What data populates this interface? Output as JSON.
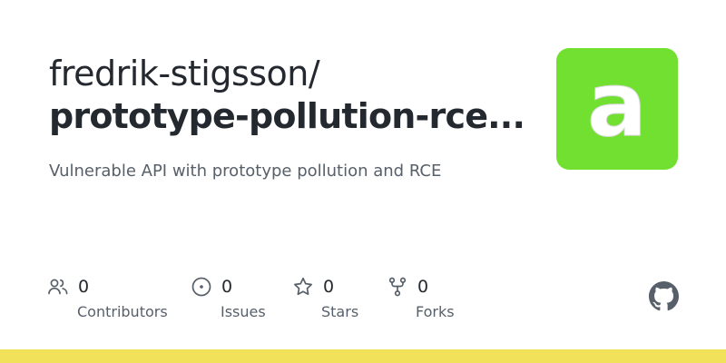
{
  "card": {
    "owner": "fredrik-stigsson/",
    "repo": "prototype-pollution-rce...",
    "description": "Vulnerable API with prototype pollution and RCE",
    "avatar": {
      "letter": "a",
      "color": "#71e030",
      "icon": "repo-avatar"
    },
    "stats": [
      {
        "key": "contributors",
        "icon": "people-icon",
        "count": "0",
        "label": "Contributors"
      },
      {
        "key": "issues",
        "icon": "issue-opened-icon",
        "count": "0",
        "label": "Issues"
      },
      {
        "key": "stars",
        "icon": "star-icon",
        "count": "0",
        "label": "Stars"
      },
      {
        "key": "forks",
        "icon": "repo-forked-icon",
        "count": "0",
        "label": "Forks"
      }
    ],
    "logo_icon": "github-mark-icon",
    "bar_color": "#f1e05a",
    "colors": {
      "title": "#24292f",
      "muted": "#57606a",
      "icon": "#57606a"
    }
  }
}
